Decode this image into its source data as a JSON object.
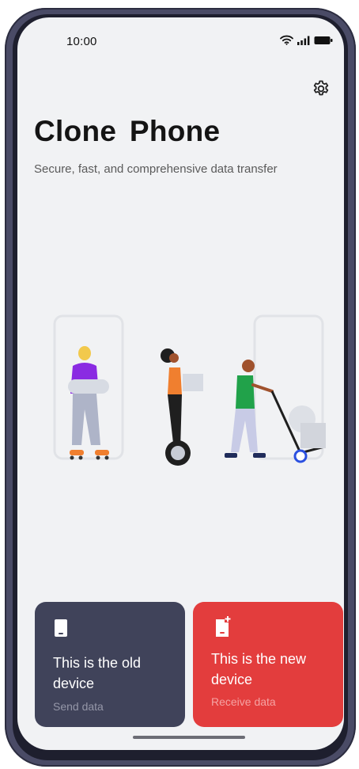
{
  "status_bar": {
    "time": "10:00"
  },
  "header": {
    "title": "Clone  Phone",
    "subtitle": "Secure, fast, and comprehensive data transfer"
  },
  "icons": {
    "settings": "gear-icon",
    "wifi": "wifi-icon",
    "signal": "signal-icon",
    "battery": "battery-icon",
    "old_device": "phone-icon",
    "new_device": "phone-plus-icon"
  },
  "cards": {
    "old_device": {
      "title": "This is the old device",
      "subtitle": "Send data"
    },
    "new_device": {
      "title": "This is the  new device",
      "subtitle": "Receive data"
    }
  },
  "colors": {
    "background": "#f1f2f4",
    "old_card": "#40435a",
    "new_card": "#e33d3d",
    "frame": "#4a4b66"
  }
}
